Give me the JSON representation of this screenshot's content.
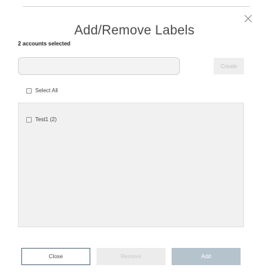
{
  "modal": {
    "title": "Add/Remove Labels",
    "selected_count_text": "2 accounts selected"
  },
  "new_label": {
    "value": "",
    "placeholder": ""
  },
  "buttons": {
    "create": "Create",
    "close": "Close",
    "remove": "Remove",
    "add": "Add"
  },
  "select_all": {
    "label": "Select All",
    "checked": false
  },
  "labels": [
    {
      "text": "Test1 (2)",
      "checked": false
    }
  ],
  "icons": {
    "close": "close-icon"
  },
  "colors": {
    "close_button_border": "#5a6f7c",
    "add_button_bg": "#b5c3cc",
    "panel_bg": "#f1f1f1",
    "disabled_bg": "#ececec"
  }
}
